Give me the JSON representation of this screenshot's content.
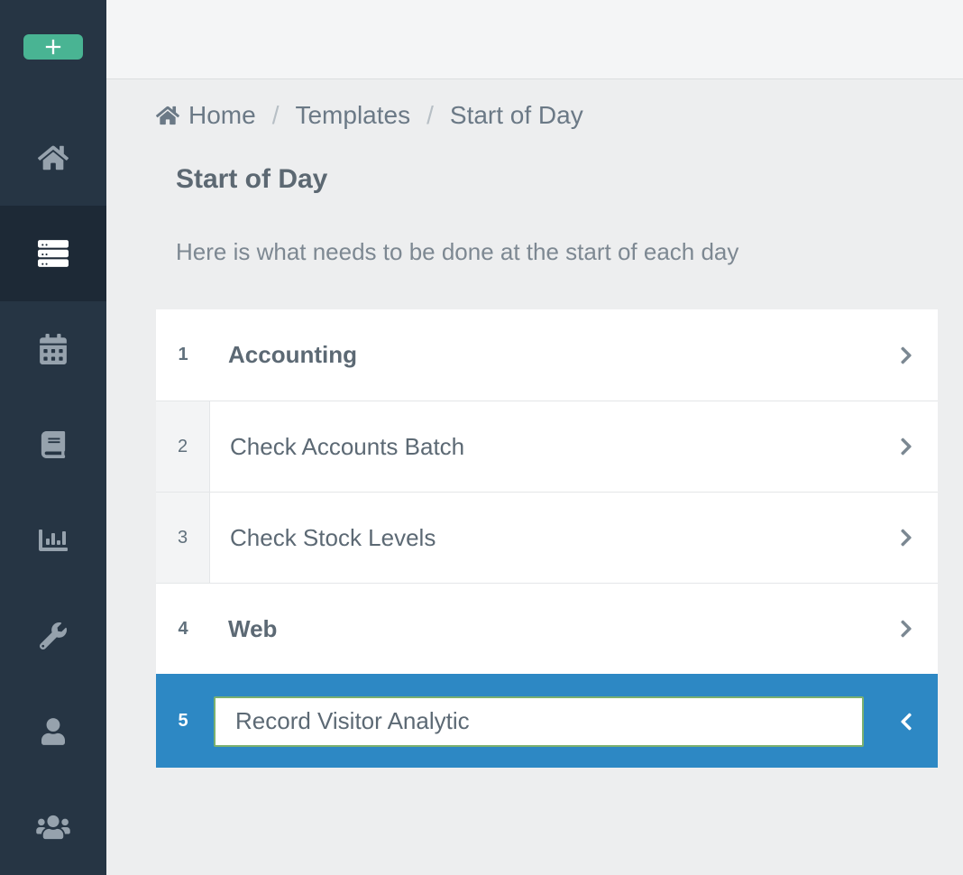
{
  "sidebar": {
    "add_tooltip": "Add",
    "items": [
      {
        "icon": "home-icon"
      },
      {
        "icon": "server-icon"
      },
      {
        "icon": "calendar-icon"
      },
      {
        "icon": "book-icon"
      },
      {
        "icon": "chart-icon"
      },
      {
        "icon": "wrench-icon"
      },
      {
        "icon": "user-icon"
      },
      {
        "icon": "users-icon"
      }
    ]
  },
  "breadcrumb": {
    "home": "Home",
    "level1": "Templates",
    "level2": "Start of Day"
  },
  "page": {
    "title": "Start of Day",
    "description": "Here is what needs to be done at the start of each day"
  },
  "list": {
    "items": [
      {
        "num": "1",
        "label": "Accounting",
        "type": "section"
      },
      {
        "num": "2",
        "label": "Check Accounts Batch",
        "type": "sub"
      },
      {
        "num": "3",
        "label": "Check Stock Levels",
        "type": "sub"
      },
      {
        "num": "4",
        "label": "Web",
        "type": "section"
      },
      {
        "num": "5",
        "value": "Record Visitor Analytic",
        "type": "edit"
      }
    ]
  }
}
